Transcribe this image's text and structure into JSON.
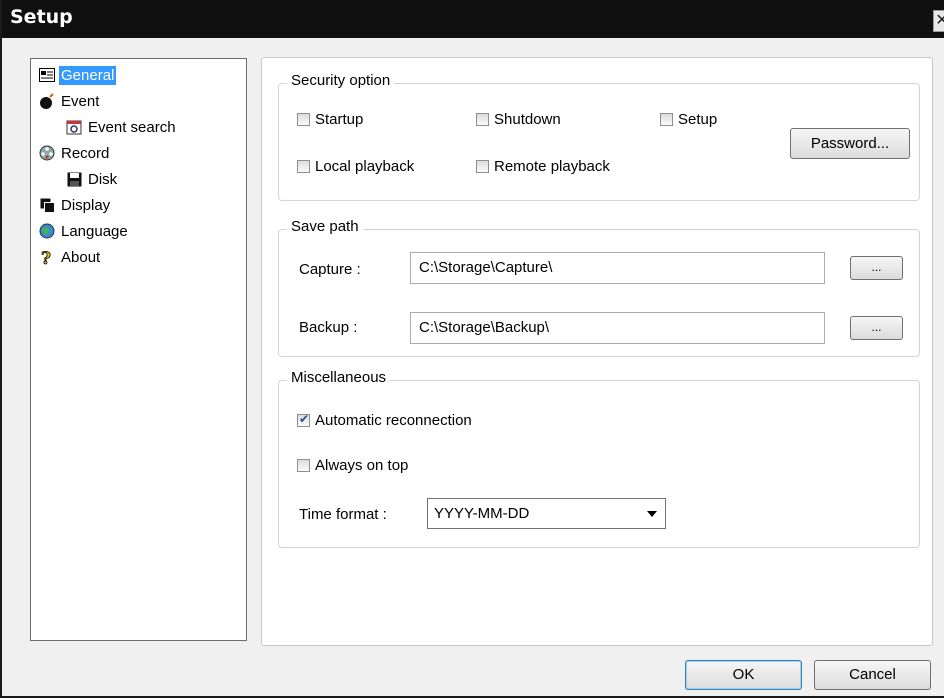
{
  "window": {
    "title": "Setup",
    "close_glyph": "✕"
  },
  "tree": {
    "items": [
      {
        "label": "General",
        "icon": "general-icon",
        "selected": true
      },
      {
        "label": "Event",
        "icon": "bomb-icon"
      },
      {
        "label": "Event search",
        "icon": "event-search-icon"
      },
      {
        "label": "Record",
        "icon": "film-reel-icon"
      },
      {
        "label": "Disk",
        "icon": "floppy-disk-icon"
      },
      {
        "label": "Display",
        "icon": "display-icon"
      },
      {
        "label": "Language",
        "icon": "globe-icon"
      },
      {
        "label": "About",
        "icon": "question-icon"
      }
    ]
  },
  "security": {
    "title": "Security option",
    "startup": "Startup",
    "shutdown": "Shutdown",
    "setup": "Setup",
    "local_playback": "Local playback",
    "remote_playback": "Remote playback",
    "password_button": "Password..."
  },
  "save_path": {
    "title": "Save path",
    "capture_label": "Capture :",
    "capture_value": "C:\\Storage\\Capture\\",
    "backup_label": "Backup :",
    "backup_value": "C:\\Storage\\Backup\\",
    "browse_label": "..."
  },
  "misc": {
    "title": "Miscellaneous",
    "auto_reconnect": "Automatic reconnection",
    "auto_reconnect_checked": true,
    "always_on_top": "Always on top",
    "always_on_top_checked": false,
    "time_format_label": "Time format :",
    "time_format_value": "YYYY-MM-DD"
  },
  "footer": {
    "ok": "OK",
    "cancel": "Cancel"
  },
  "colors": {
    "selection": "#3399ff",
    "titlebar": "#101010"
  }
}
